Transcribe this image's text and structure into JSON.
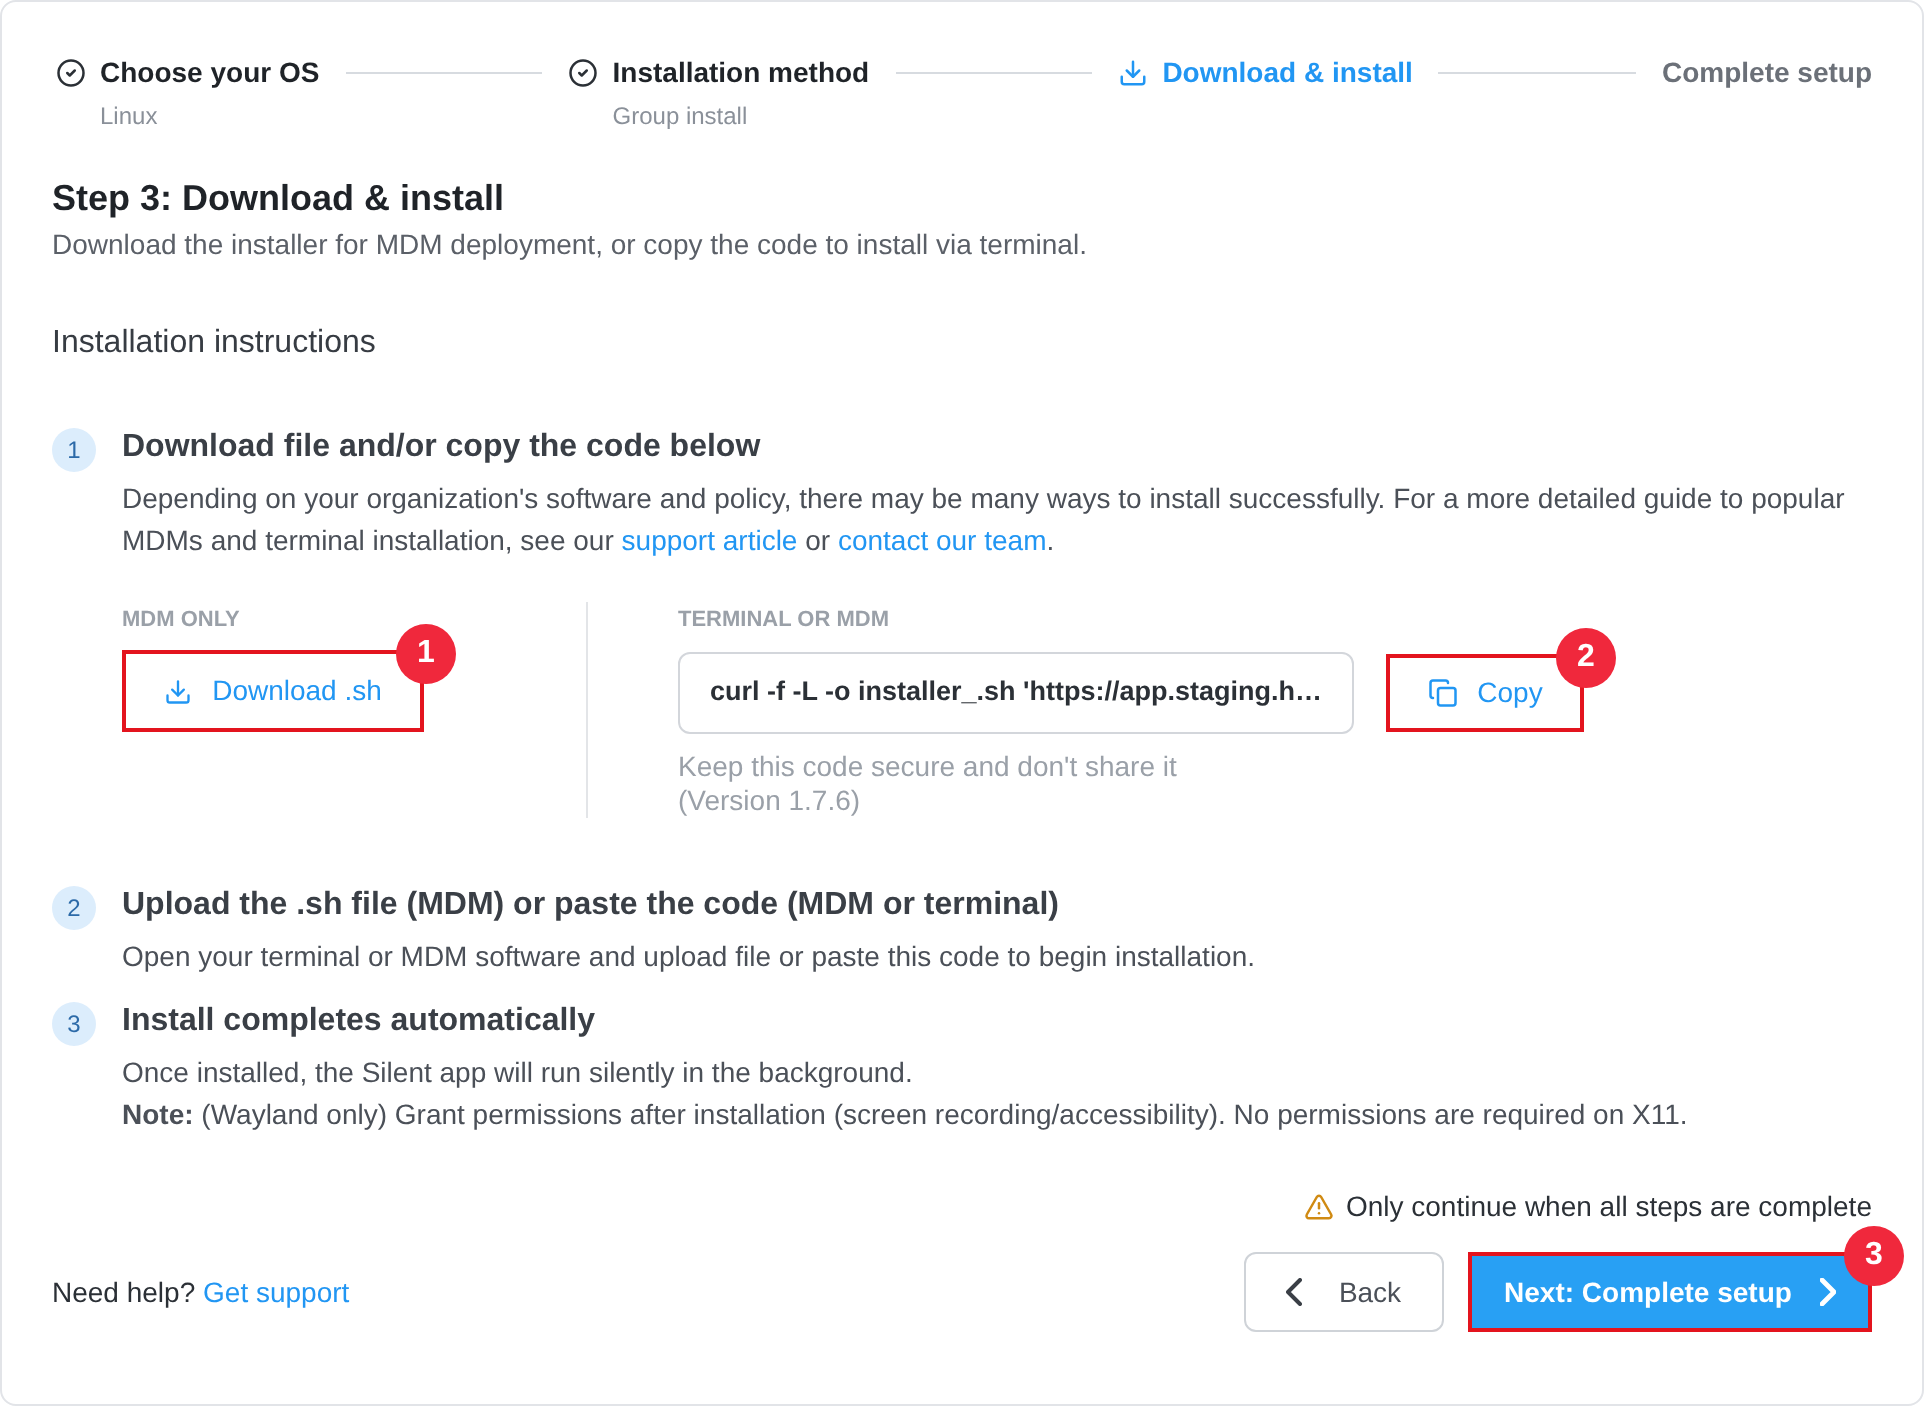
{
  "stepper": [
    {
      "label": "Choose your OS",
      "sublabel": "Linux",
      "kind": "done"
    },
    {
      "label": "Installation method",
      "sublabel": "Group install",
      "kind": "done"
    },
    {
      "label": "Download & install",
      "kind": "current"
    },
    {
      "label": "Complete setup",
      "kind": "upcoming"
    }
  ],
  "header": {
    "title": "Step 3: Download & install",
    "subtitle": "Download the installer for MDM deployment, or copy the code to install via terminal."
  },
  "section_title": "Installation instructions",
  "steps": [
    {
      "number": "1",
      "title": "Download file and/or copy the code below",
      "description": [
        {
          "kind": "text",
          "text": "Depending on your organization's software and policy, there may be many ways to install successfully. For a more detailed guide to popular MDMs and terminal installation, see our "
        },
        {
          "kind": "link",
          "text": "support article"
        },
        {
          "kind": "text",
          "text": " or "
        },
        {
          "kind": "link",
          "text": "contact our team"
        },
        {
          "kind": "text",
          "text": "."
        }
      ],
      "options": {
        "download": {
          "label": "MDM ONLY",
          "button": "Download .sh",
          "callout": "1"
        },
        "terminal": {
          "label": "TERMINAL OR MDM",
          "code": "curl -f -L -o installer_.sh 'https://app.staging.h…",
          "button": "Copy",
          "callout": "2",
          "hint": "Keep this code secure and don't share it",
          "version": "(Version 1.7.6)"
        }
      }
    },
    {
      "number": "2",
      "title": "Upload the .sh file (MDM) or paste the code (MDM or terminal)",
      "description": [
        {
          "kind": "text",
          "text": "Open your terminal or MDM software and upload file or paste this code to begin installation."
        }
      ]
    },
    {
      "number": "3",
      "title": "Install completes automatically",
      "description": [
        {
          "kind": "text",
          "text": "Once installed, the Silent app will run silently in the background."
        }
      ],
      "note": "**Note:** (Wayland only) Grant permissions after installation (screen recording/accessibility). No permissions are required on X11."
    }
  ],
  "footer": {
    "warning": "Only continue when all steps are complete",
    "help_text": "Need help?",
    "help_link": "Get support",
    "back_button": "Back",
    "next_button": "Next: Complete setup",
    "next_callout": "3"
  }
}
